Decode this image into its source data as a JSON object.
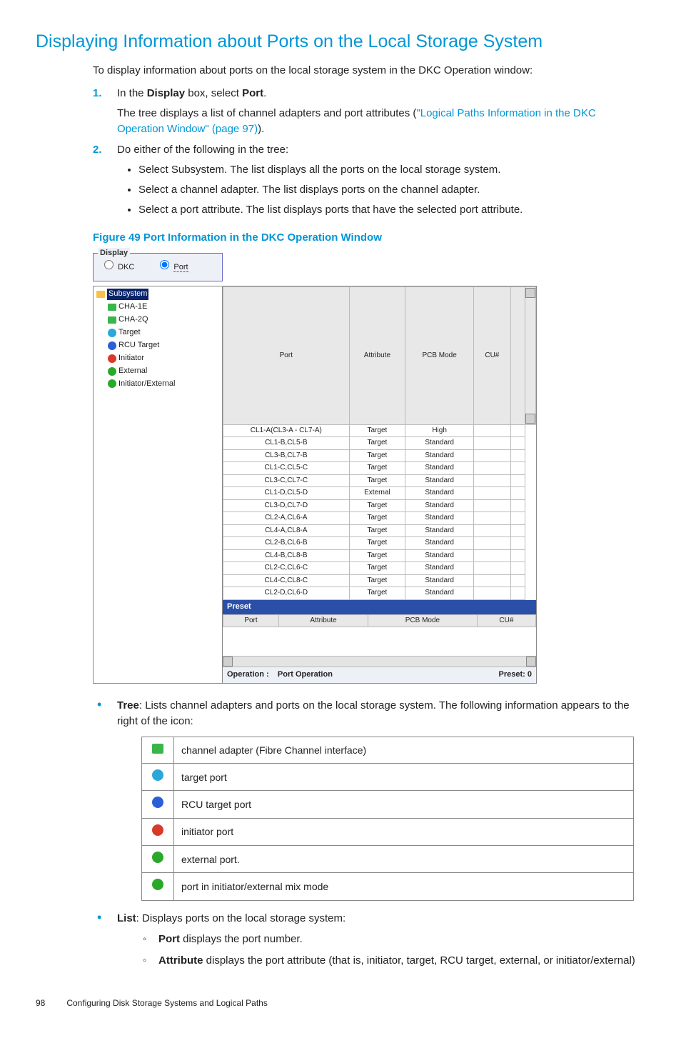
{
  "title": "Displaying Information about Ports on the Local Storage System",
  "intro": "To display information about ports on the local storage system in the DKC Operation window:",
  "steps": {
    "s1_a": "In the ",
    "s1_b": "Display",
    "s1_c": " box, select ",
    "s1_d": "Port",
    "s1_e": ".",
    "s1_desc_a": "The tree displays a list of channel adapters and port attributes (",
    "s1_link": "\"Logical Paths Information in the DKC Operation Window\" (page 97)",
    "s1_desc_b": ").",
    "s2": "Do either of the following in the tree:",
    "s2_b1": "Select Subsystem. The list displays all the ports on the local storage system.",
    "s2_b2": "Select a channel adapter. The list displays ports on the channel adapter.",
    "s2_b3": "Select a port attribute. The list displays ports that have the selected port attribute."
  },
  "fig_caption": "Figure 49 Port Information in the DKC Operation Window",
  "display_box": {
    "legend": "Display",
    "dkc": "DKC",
    "port": "Port"
  },
  "tree": {
    "root": "Subsystem",
    "items": [
      "CHA-1E",
      "CHA-2Q",
      "Target",
      "RCU Target",
      "Initiator",
      "External",
      "Initiator/External"
    ]
  },
  "headers": {
    "port": "Port",
    "attr": "Attribute",
    "pcb": "PCB Mode",
    "cu": "CU#"
  },
  "rows": [
    {
      "port": "CL1-A(CL3-A - CL7-A)",
      "attr": "Target",
      "pcb": "High"
    },
    {
      "port": "CL1-B,CL5-B",
      "attr": "Target",
      "pcb": "Standard"
    },
    {
      "port": "CL3-B,CL7-B",
      "attr": "Target",
      "pcb": "Standard"
    },
    {
      "port": "CL1-C,CL5-C",
      "attr": "Target",
      "pcb": "Standard"
    },
    {
      "port": "CL3-C,CL7-C",
      "attr": "Target",
      "pcb": "Standard"
    },
    {
      "port": "CL1-D,CL5-D",
      "attr": "External",
      "pcb": "Standard"
    },
    {
      "port": "CL3-D,CL7-D",
      "attr": "Target",
      "pcb": "Standard"
    },
    {
      "port": "CL2-A,CL6-A",
      "attr": "Target",
      "pcb": "Standard"
    },
    {
      "port": "CL4-A,CL8-A",
      "attr": "Target",
      "pcb": "Standard"
    },
    {
      "port": "CL2-B,CL6-B",
      "attr": "Target",
      "pcb": "Standard"
    },
    {
      "port": "CL4-B,CL8-B",
      "attr": "Target",
      "pcb": "Standard"
    },
    {
      "port": "CL2-C,CL6-C",
      "attr": "Target",
      "pcb": "Standard"
    },
    {
      "port": "CL4-C,CL8-C",
      "attr": "Target",
      "pcb": "Standard"
    },
    {
      "port": "CL2-D,CL6-D",
      "attr": "Target",
      "pcb": "Standard"
    }
  ],
  "preset": {
    "title": "Preset",
    "h_port": "Port",
    "h_attr": "Attribute",
    "h_pcb": "PCB Mode",
    "h_cu": "CU#"
  },
  "status": {
    "op_label": "Operation :",
    "op_value": "Port Operation",
    "preset_label": "Preset: 0"
  },
  "tree_def_a": "Tree",
  "tree_def_b": ": Lists channel adapters and ports on the local storage system. The following information appears to the right of the icon:",
  "legend_tbl": [
    "channel adapter (Fibre Channel interface)",
    "target port",
    "RCU target port",
    "initiator port",
    "external port.",
    "port in initiator/external mix mode"
  ],
  "list_def_a": "List",
  "list_def_b": ": Displays ports on the local storage system:",
  "list_sub1_a": "Port",
  "list_sub1_b": " displays the port number.",
  "list_sub2_a": "Attribute",
  "list_sub2_b": " displays the port attribute (that is, initiator, target, RCU target, external, or initiator/external)",
  "footer": {
    "page": "98",
    "chapter": "Configuring Disk Storage Systems and Logical Paths"
  }
}
